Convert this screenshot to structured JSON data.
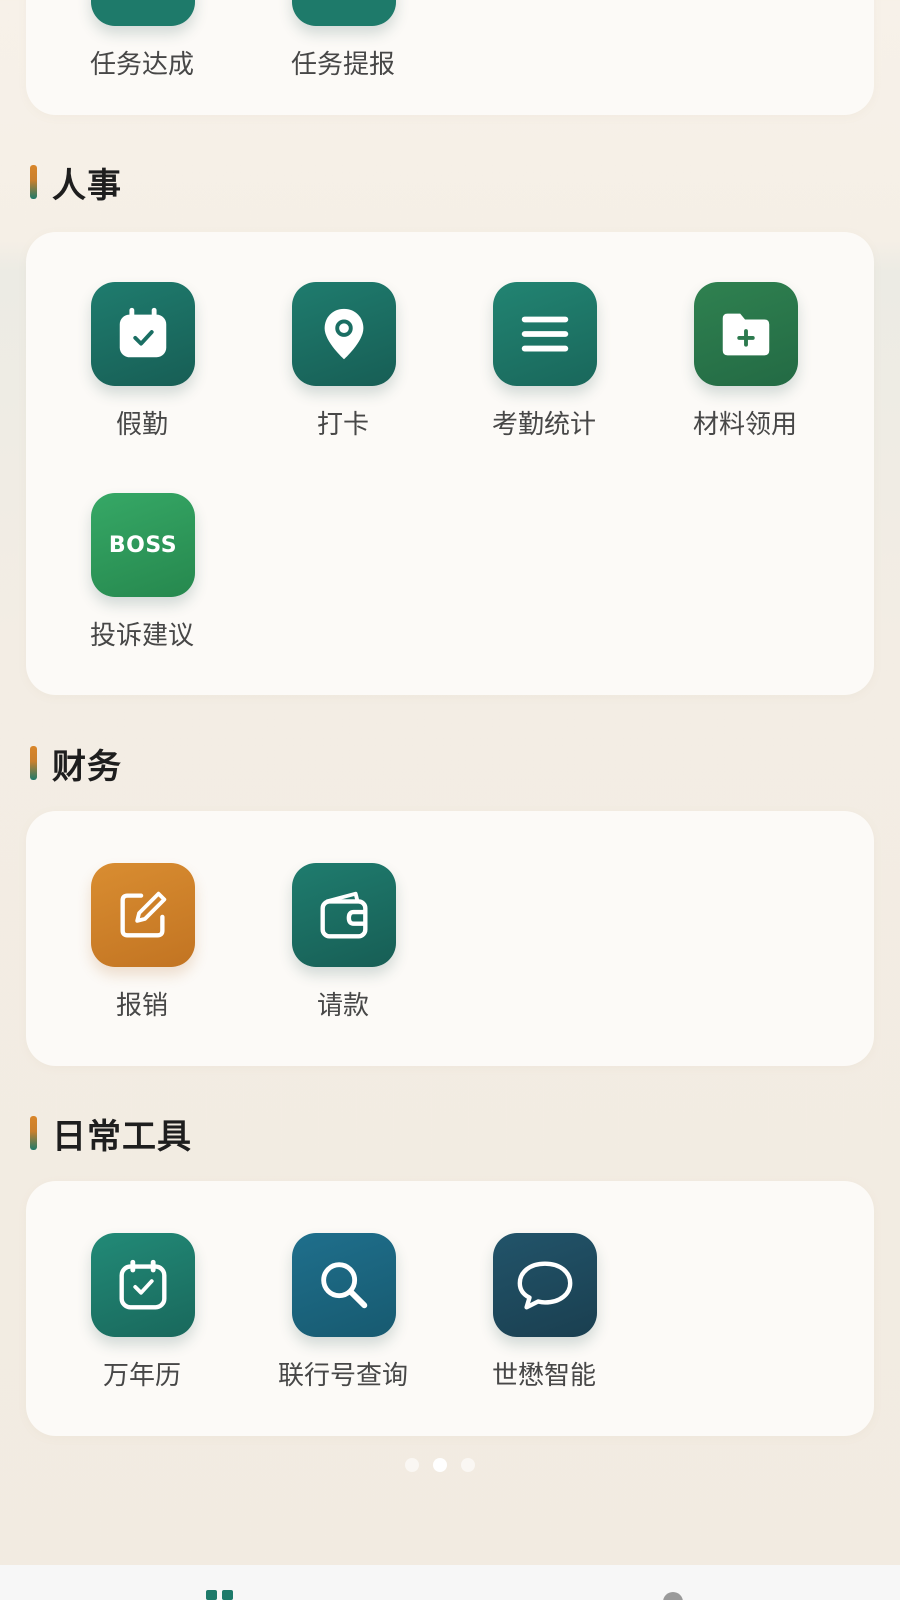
{
  "top_section": {
    "items": [
      {
        "label": "任务达成",
        "color": "#1e7a6a"
      },
      {
        "label": "任务提报",
        "color": "#1e7a6a"
      }
    ]
  },
  "hr": {
    "title": "人事",
    "items": [
      {
        "label": "假勤",
        "icon": "calendar-check-icon",
        "color": "#1a6e63"
      },
      {
        "label": "打卡",
        "icon": "location-pin-icon",
        "color": "#1a6e63"
      },
      {
        "label": "考勤统计",
        "icon": "list-lines-icon",
        "color": "#1a7a6b"
      },
      {
        "label": "材料领用",
        "icon": "folder-plus-icon",
        "color": "#2c7a4e"
      },
      {
        "label": "投诉建议",
        "icon": "boss-icon",
        "icon_text": "BOSS",
        "color": "#2e9a5c"
      }
    ]
  },
  "finance": {
    "title": "财务",
    "items": [
      {
        "label": "报销",
        "icon": "edit-square-icon",
        "color": "#d2862c"
      },
      {
        "label": "请款",
        "icon": "wallet-icon",
        "color": "#1a6e63"
      }
    ]
  },
  "tools": {
    "title": "日常工具",
    "items": [
      {
        "label": "万年历",
        "icon": "calendar-check-icon",
        "color": "#1a7a6b"
      },
      {
        "label": "联行号查询",
        "icon": "search-icon",
        "color": "#1a5e7a"
      },
      {
        "label": "世懋智能",
        "icon": "chat-bubble-icon",
        "color": "#1d4a5c"
      }
    ]
  },
  "pager": {
    "count": 3,
    "active": 1
  }
}
